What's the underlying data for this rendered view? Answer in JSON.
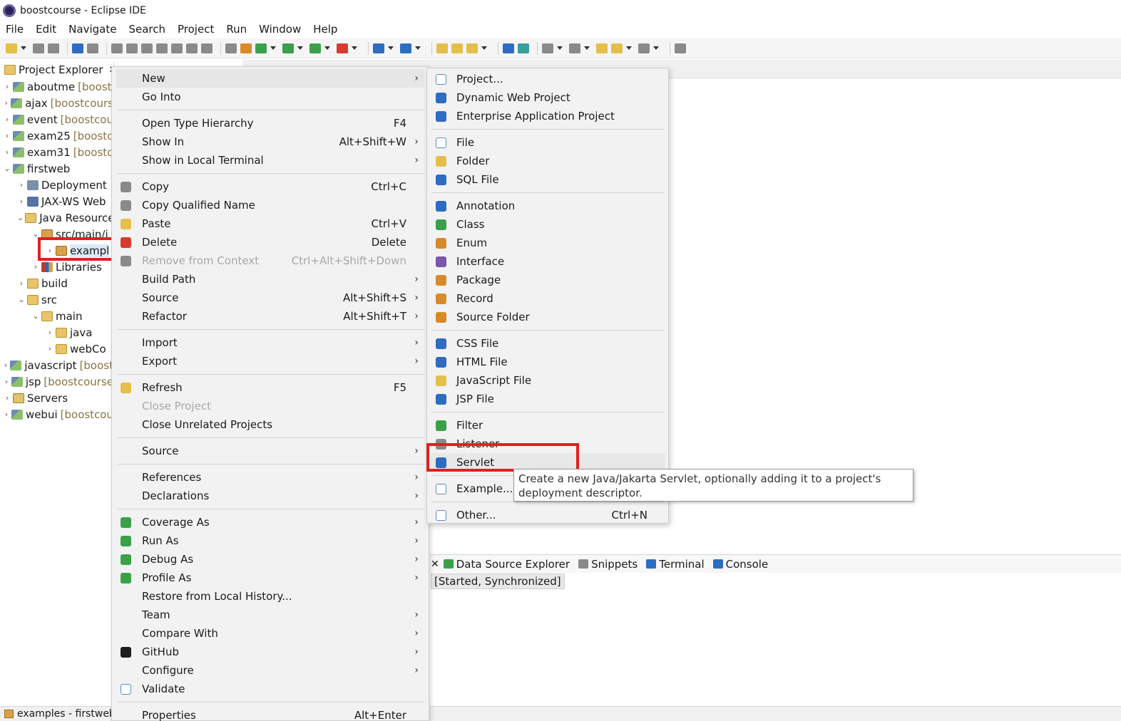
{
  "window": {
    "title": "boostcourse - Eclipse IDE"
  },
  "menubar": [
    "File",
    "Edit",
    "Navigate",
    "Search",
    "Project",
    "Run",
    "Window",
    "Help"
  ],
  "explorer": {
    "tab_label": "Project Explorer",
    "rows": [
      {
        "label": "aboutme",
        "extra": "[boost",
        "indent": 0,
        "twisty": "›",
        "icon": "project-icon"
      },
      {
        "label": "ajax",
        "extra": "[boostcours",
        "indent": 0,
        "twisty": "›",
        "icon": "project-icon"
      },
      {
        "label": "event",
        "extra": "[boostcou",
        "indent": 0,
        "twisty": "›",
        "icon": "project-icon"
      },
      {
        "label": "exam25",
        "extra": "[boostc",
        "indent": 0,
        "twisty": "›",
        "icon": "project-icon"
      },
      {
        "label": "exam31",
        "extra": "[boostc",
        "indent": 0,
        "twisty": "›",
        "icon": "project-icon"
      },
      {
        "label": "firstweb",
        "extra": "",
        "indent": 0,
        "twisty": "⌄",
        "icon": "project-icon"
      },
      {
        "label": "Deployment",
        "extra": "",
        "indent": 1,
        "twisty": "›",
        "icon": "deployment-icon"
      },
      {
        "label": "JAX-WS Web",
        "extra": "",
        "indent": 1,
        "twisty": "›",
        "icon": "webservice-icon"
      },
      {
        "label": "Java Resource",
        "extra": "",
        "indent": 1,
        "twisty": "⌄",
        "icon": "java-resources-icon"
      },
      {
        "label": "src/main/j",
        "extra": "",
        "indent": 2,
        "twisty": "⌄",
        "icon": "source-folder-icon"
      },
      {
        "label": "exampl",
        "extra": "",
        "indent": 3,
        "twisty": "›",
        "icon": "package-icon",
        "selected": true
      },
      {
        "label": "Libraries",
        "extra": "",
        "indent": 2,
        "twisty": "›",
        "icon": "libraries-icon"
      },
      {
        "label": "build",
        "extra": "",
        "indent": 1,
        "twisty": "›",
        "icon": "folder-icon"
      },
      {
        "label": "src",
        "extra": "",
        "indent": 1,
        "twisty": "⌄",
        "icon": "folder-icon"
      },
      {
        "label": "main",
        "extra": "",
        "indent": 2,
        "twisty": "⌄",
        "icon": "folder-icon"
      },
      {
        "label": "java",
        "extra": "",
        "indent": 3,
        "twisty": "›",
        "icon": "folder-icon"
      },
      {
        "label": "webCo",
        "extra": "",
        "indent": 3,
        "twisty": "›",
        "icon": "folder-icon"
      },
      {
        "label": "javascript",
        "extra": "[boost",
        "indent": 0,
        "twisty": "›",
        "icon": "project-icon"
      },
      {
        "label": "jsp",
        "extra": "[boostcourse",
        "indent": 0,
        "twisty": "›",
        "icon": "project-icon"
      },
      {
        "label": "Servers",
        "extra": "",
        "indent": 0,
        "twisty": "›",
        "icon": "servers-folder-icon"
      },
      {
        "label": "webui",
        "extra": "[boostcou",
        "indent": 0,
        "twisty": "›",
        "icon": "project-icon"
      }
    ]
  },
  "context_menu": {
    "items": [
      {
        "label": "New",
        "shortcut": "",
        "submenu": true,
        "icon": "",
        "disabled": false,
        "highlighted": true
      },
      {
        "label": "Go Into",
        "shortcut": "",
        "submenu": false,
        "icon": "",
        "disabled": false
      },
      {
        "separator": true
      },
      {
        "label": "Open Type Hierarchy",
        "shortcut": "F4",
        "submenu": false,
        "icon": "",
        "disabled": false
      },
      {
        "label": "Show In",
        "shortcut": "Alt+Shift+W",
        "submenu": true,
        "icon": "",
        "disabled": false
      },
      {
        "label": "Show in Local Terminal",
        "shortcut": "",
        "submenu": true,
        "icon": "",
        "disabled": false
      },
      {
        "separator": true
      },
      {
        "label": "Copy",
        "shortcut": "Ctrl+C",
        "submenu": false,
        "icon": "copy-icon",
        "disabled": false
      },
      {
        "label": "Copy Qualified Name",
        "shortcut": "",
        "submenu": false,
        "icon": "copy-qualified-icon",
        "disabled": false
      },
      {
        "label": "Paste",
        "shortcut": "Ctrl+V",
        "submenu": false,
        "icon": "paste-icon",
        "disabled": false
      },
      {
        "label": "Delete",
        "shortcut": "Delete",
        "submenu": false,
        "icon": "delete-icon",
        "disabled": false
      },
      {
        "label": "Remove from Context",
        "shortcut": "Ctrl+Alt+Shift+Down",
        "submenu": false,
        "icon": "remove-context-icon",
        "disabled": true
      },
      {
        "label": "Build Path",
        "shortcut": "",
        "submenu": true,
        "icon": "",
        "disabled": false
      },
      {
        "label": "Source",
        "shortcut": "Alt+Shift+S",
        "submenu": true,
        "icon": "",
        "disabled": false
      },
      {
        "label": "Refactor",
        "shortcut": "Alt+Shift+T",
        "submenu": true,
        "icon": "",
        "disabled": false
      },
      {
        "separator": true
      },
      {
        "label": "Import",
        "shortcut": "",
        "submenu": true,
        "icon": "",
        "disabled": false
      },
      {
        "label": "Export",
        "shortcut": "",
        "submenu": true,
        "icon": "",
        "disabled": false
      },
      {
        "separator": true
      },
      {
        "label": "Refresh",
        "shortcut": "F5",
        "submenu": false,
        "icon": "refresh-icon",
        "disabled": false
      },
      {
        "label": "Close Project",
        "shortcut": "",
        "submenu": false,
        "icon": "",
        "disabled": true
      },
      {
        "label": "Close Unrelated Projects",
        "shortcut": "",
        "submenu": false,
        "icon": "",
        "disabled": false
      },
      {
        "separator": true
      },
      {
        "label": "Source",
        "shortcut": "",
        "submenu": true,
        "icon": "",
        "disabled": false
      },
      {
        "separator": true
      },
      {
        "label": "References",
        "shortcut": "",
        "submenu": true,
        "icon": "",
        "disabled": false
      },
      {
        "label": "Declarations",
        "shortcut": "",
        "submenu": true,
        "icon": "",
        "disabled": false
      },
      {
        "separator": true
      },
      {
        "label": "Coverage As",
        "shortcut": "",
        "submenu": true,
        "icon": "coverage-icon",
        "disabled": false
      },
      {
        "label": "Run As",
        "shortcut": "",
        "submenu": true,
        "icon": "run-icon",
        "disabled": false
      },
      {
        "label": "Debug As",
        "shortcut": "",
        "submenu": true,
        "icon": "debug-icon",
        "disabled": false
      },
      {
        "label": "Profile As",
        "shortcut": "",
        "submenu": true,
        "icon": "profile-icon",
        "disabled": false
      },
      {
        "label": "Restore from Local History...",
        "shortcut": "",
        "submenu": false,
        "icon": "",
        "disabled": false
      },
      {
        "label": "Team",
        "shortcut": "",
        "submenu": true,
        "icon": "",
        "disabled": false
      },
      {
        "label": "Compare With",
        "shortcut": "",
        "submenu": true,
        "icon": "",
        "disabled": false
      },
      {
        "label": "GitHub",
        "shortcut": "",
        "submenu": true,
        "icon": "github-icon",
        "disabled": false
      },
      {
        "label": "Configure",
        "shortcut": "",
        "submenu": true,
        "icon": "",
        "disabled": false
      },
      {
        "label": "Validate",
        "shortcut": "",
        "submenu": false,
        "icon": "validate-icon",
        "disabled": false
      },
      {
        "separator": true
      },
      {
        "label": "Properties",
        "shortcut": "Alt+Enter",
        "submenu": false,
        "icon": "",
        "disabled": false
      }
    ]
  },
  "new_submenu": {
    "items": [
      {
        "label": "Project...",
        "shortcut": "",
        "icon": "new-project-icon"
      },
      {
        "label": "Dynamic Web Project",
        "shortcut": "",
        "icon": "dynamic-web-project-icon"
      },
      {
        "label": "Enterprise Application Project",
        "shortcut": "",
        "icon": "enterprise-project-icon"
      },
      {
        "separator": true
      },
      {
        "label": "File",
        "shortcut": "",
        "icon": "file-icon"
      },
      {
        "label": "Folder",
        "shortcut": "",
        "icon": "folder-icon"
      },
      {
        "label": "SQL File",
        "shortcut": "",
        "icon": "sql-file-icon"
      },
      {
        "separator": true
      },
      {
        "label": "Annotation",
        "shortcut": "",
        "icon": "annotation-icon"
      },
      {
        "label": "Class",
        "shortcut": "",
        "icon": "class-icon"
      },
      {
        "label": "Enum",
        "shortcut": "",
        "icon": "enum-icon"
      },
      {
        "label": "Interface",
        "shortcut": "",
        "icon": "interface-icon"
      },
      {
        "label": "Package",
        "shortcut": "",
        "icon": "package-icon"
      },
      {
        "label": "Record",
        "shortcut": "",
        "icon": "record-icon"
      },
      {
        "label": "Source Folder",
        "shortcut": "",
        "icon": "source-folder-icon"
      },
      {
        "separator": true
      },
      {
        "label": "CSS File",
        "shortcut": "",
        "icon": "css-file-icon"
      },
      {
        "label": "HTML File",
        "shortcut": "",
        "icon": "html-file-icon"
      },
      {
        "label": "JavaScript File",
        "shortcut": "",
        "icon": "javascript-file-icon"
      },
      {
        "label": "JSP File",
        "shortcut": "",
        "icon": "jsp-file-icon"
      },
      {
        "separator": true
      },
      {
        "label": "Filter",
        "shortcut": "",
        "icon": "filter-icon"
      },
      {
        "label": "Listener",
        "shortcut": "",
        "icon": "listener-icon"
      },
      {
        "label": "Servlet",
        "shortcut": "",
        "icon": "servlet-icon",
        "highlighted": true
      },
      {
        "separator": true
      },
      {
        "label": "Example...",
        "shortcut": "",
        "icon": "example-icon"
      },
      {
        "separator": true
      },
      {
        "label": "Other...",
        "shortcut": "Ctrl+N",
        "icon": "other-icon"
      }
    ]
  },
  "tooltip": {
    "text": "Create a new Java/Jakarta Servlet, optionally adding it to a project's deployment descriptor."
  },
  "bottom_panel": {
    "tabs": [
      {
        "label": "Data Source Explorer",
        "icon": "data-source-icon"
      },
      {
        "label": "Snippets",
        "icon": "snippets-icon"
      },
      {
        "label": "Terminal",
        "icon": "terminal-icon"
      },
      {
        "label": "Console",
        "icon": "console-icon"
      }
    ],
    "status": "[Started, Synchronized]"
  },
  "statusbar": {
    "text": "examples - firstweb"
  },
  "colors": {
    "highlight_box": "#e02020",
    "menu_bg": "#f2f2f2",
    "selection": "#dce9f8",
    "disabled_text": "#a8a8a8"
  }
}
